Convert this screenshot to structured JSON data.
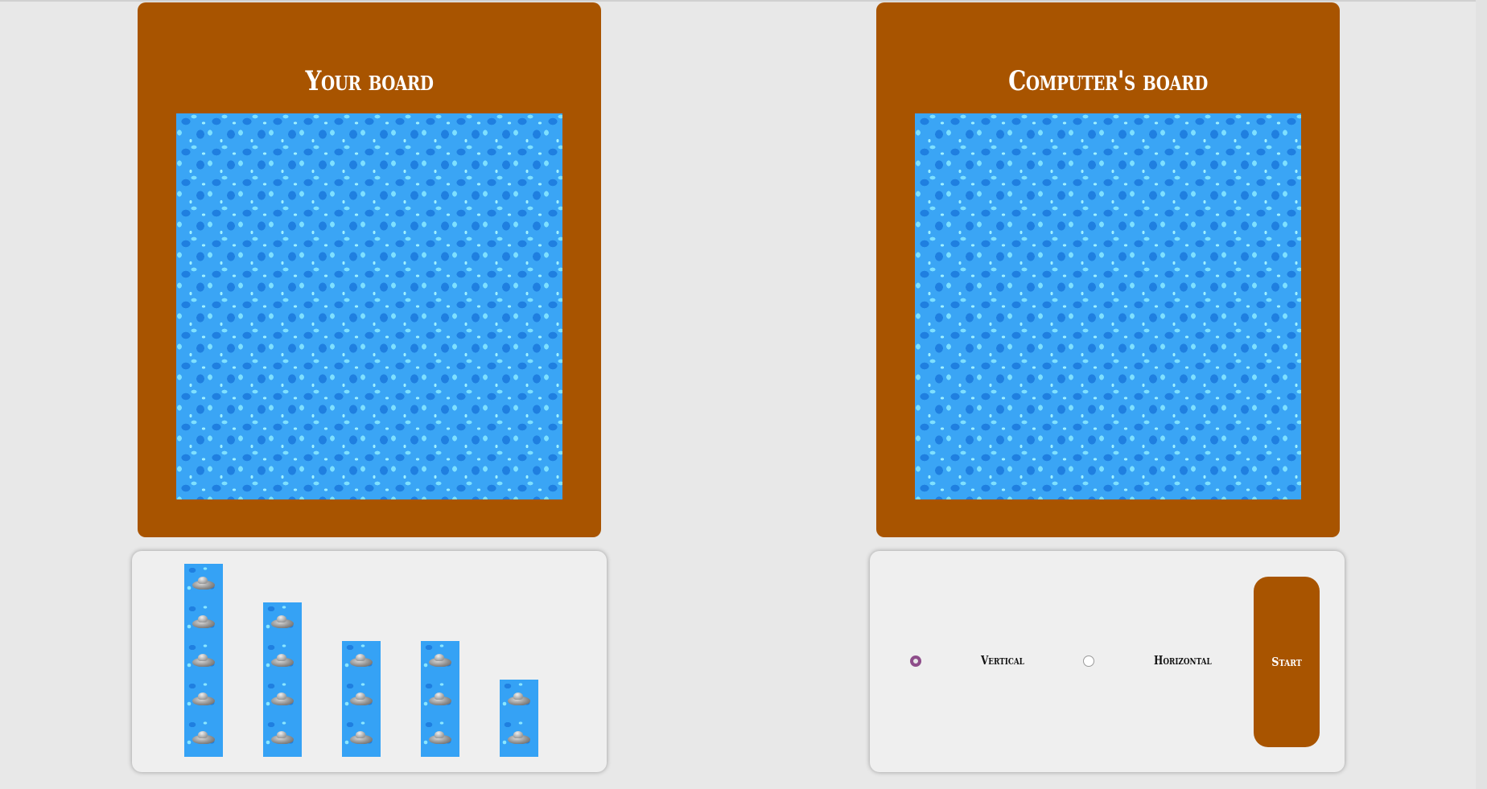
{
  "player_board": {
    "title": "Your board"
  },
  "computer_board": {
    "title": "Computer's board"
  },
  "fleet": {
    "ships": [
      {
        "name": "ship-5",
        "length": 5
      },
      {
        "name": "ship-4",
        "length": 4
      },
      {
        "name": "ship-3a",
        "length": 3
      },
      {
        "name": "ship-3b",
        "length": 3
      },
      {
        "name": "ship-2",
        "length": 2
      }
    ]
  },
  "controls": {
    "orientation_selected": "vertical",
    "vertical_label": "Vertical",
    "horizontal_label": "Horizontal",
    "start_label": "Start"
  },
  "colors": {
    "panel_brown": "#a85400",
    "water_blue": "#3aa5f5",
    "radio_accent": "#8e4d8a"
  }
}
